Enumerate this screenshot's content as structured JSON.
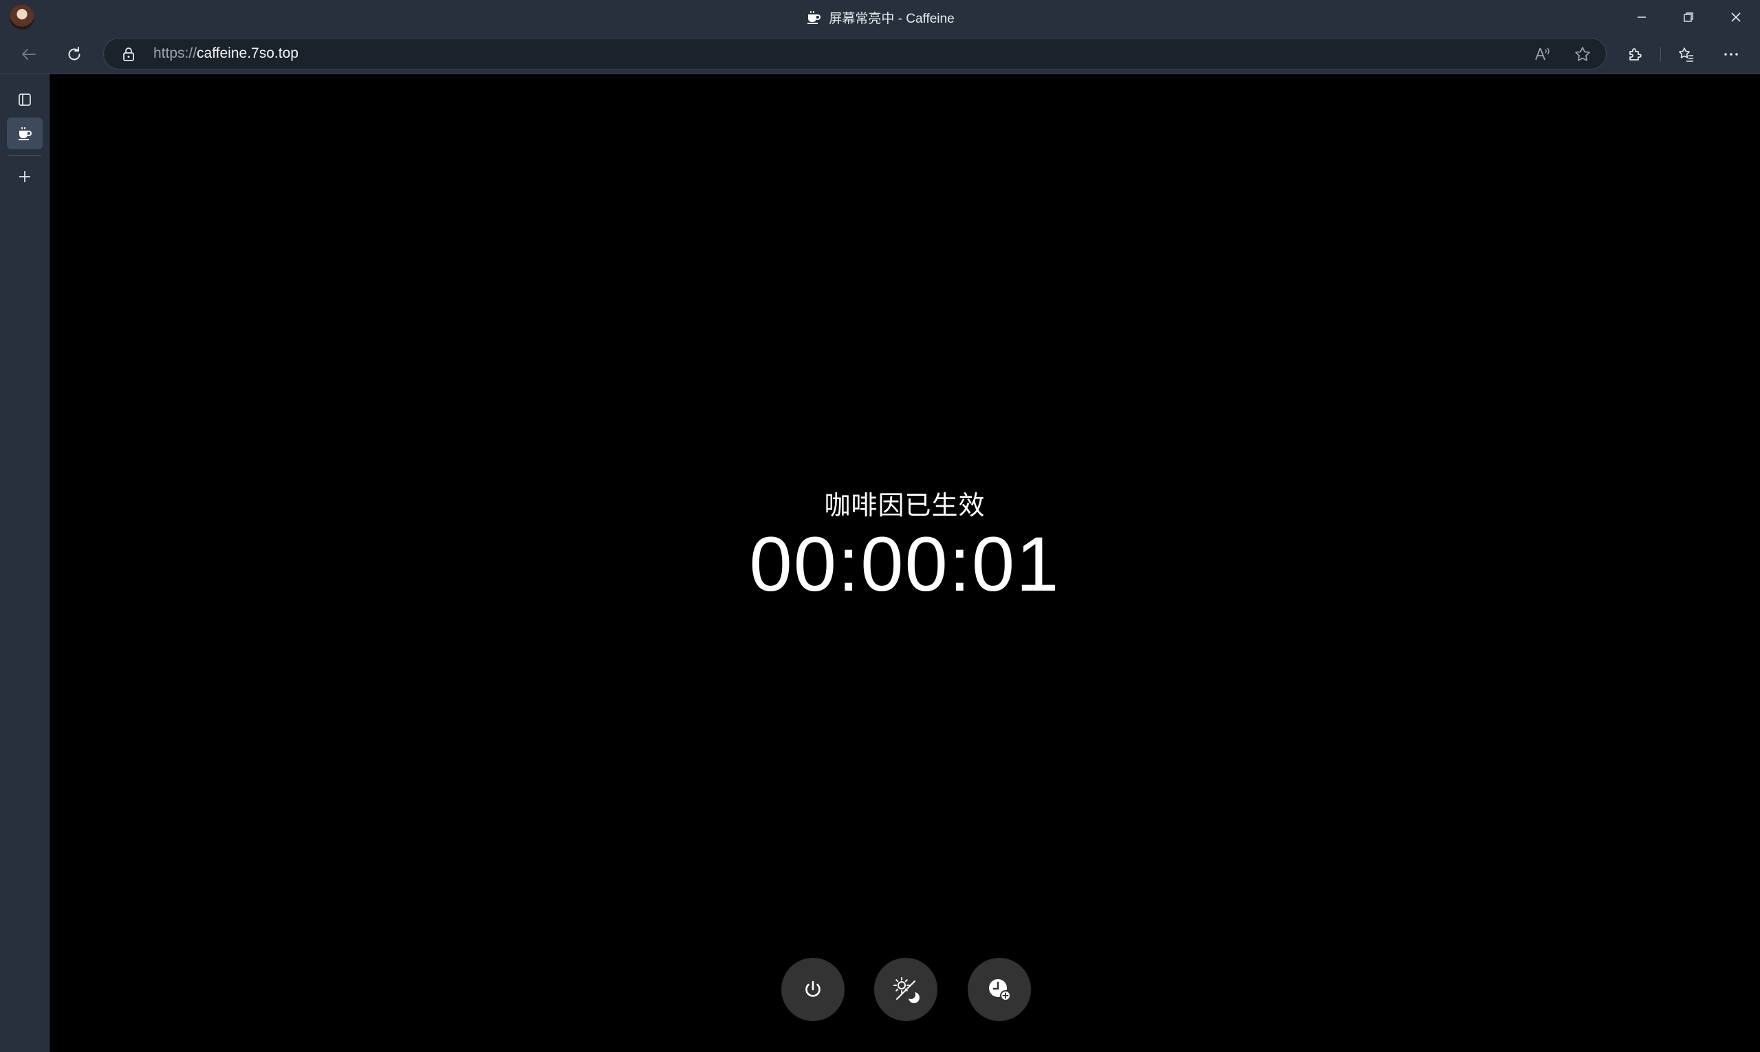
{
  "browser": {
    "window_title": "屏幕常亮中 - Caffeine",
    "url_scheme": "https://",
    "url_host": "caffeine.7so.top",
    "icons": {
      "profile": "profile-avatar",
      "favicon": "coffee-cup-icon",
      "back": "back-arrow-icon",
      "refresh": "refresh-icon",
      "lock": "lock-icon",
      "read_aloud": "read-aloud-icon",
      "favorite": "star-icon",
      "extensions": "puzzle-icon",
      "favorites_list": "favorites-list-icon",
      "more": "more-dots-icon",
      "tab_actions": "tab-actions-icon",
      "new_tab": "plus-icon"
    },
    "colors": {
      "chrome_bg": "#27303c",
      "address_bg": "#1b222b",
      "active_tab": "#3c4a5c"
    }
  },
  "page": {
    "status_text": "咖啡因已生效",
    "timer": "00:00:01",
    "background": "#000000",
    "buttons": [
      {
        "name": "power-button",
        "icon": "power-icon"
      },
      {
        "name": "brightness-mode-button",
        "icon": "sun-moon-icon"
      },
      {
        "name": "timer-button",
        "icon": "clock-plus-icon"
      }
    ],
    "button_bg": "#333333"
  }
}
